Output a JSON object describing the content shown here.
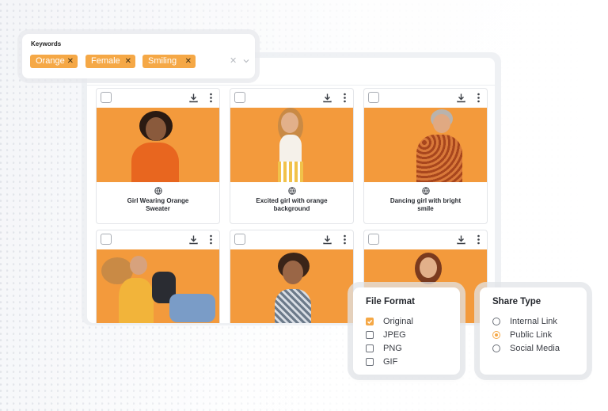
{
  "keywords": {
    "label": "Keywords",
    "chips": [
      "Orange",
      "Female",
      "Smiling"
    ],
    "clear_icon": "close-icon",
    "dropdown_icon": "chevron-down-icon"
  },
  "gallery": {
    "cards": [
      {
        "title": "Girl Wearing Orange Sweater"
      },
      {
        "title": "Excited girl with orange background"
      },
      {
        "title": "Dancing girl with bright smile"
      },
      {
        "title": ""
      },
      {
        "title": ""
      },
      {
        "title": ""
      }
    ]
  },
  "file_format": {
    "title": "File Format",
    "options": [
      {
        "label": "Original",
        "checked": true
      },
      {
        "label": "JPEG",
        "checked": false
      },
      {
        "label": "PNG",
        "checked": false
      },
      {
        "label": "GIF",
        "checked": false
      }
    ]
  },
  "share_type": {
    "title": "Share Type",
    "options": [
      {
        "label": "Internal Link",
        "selected": false
      },
      {
        "label": "Public Link",
        "selected": true
      },
      {
        "label": "Social Media",
        "selected": false
      }
    ]
  },
  "colors": {
    "accent": "#f5a846",
    "photo_bg": "#f39a3c"
  }
}
